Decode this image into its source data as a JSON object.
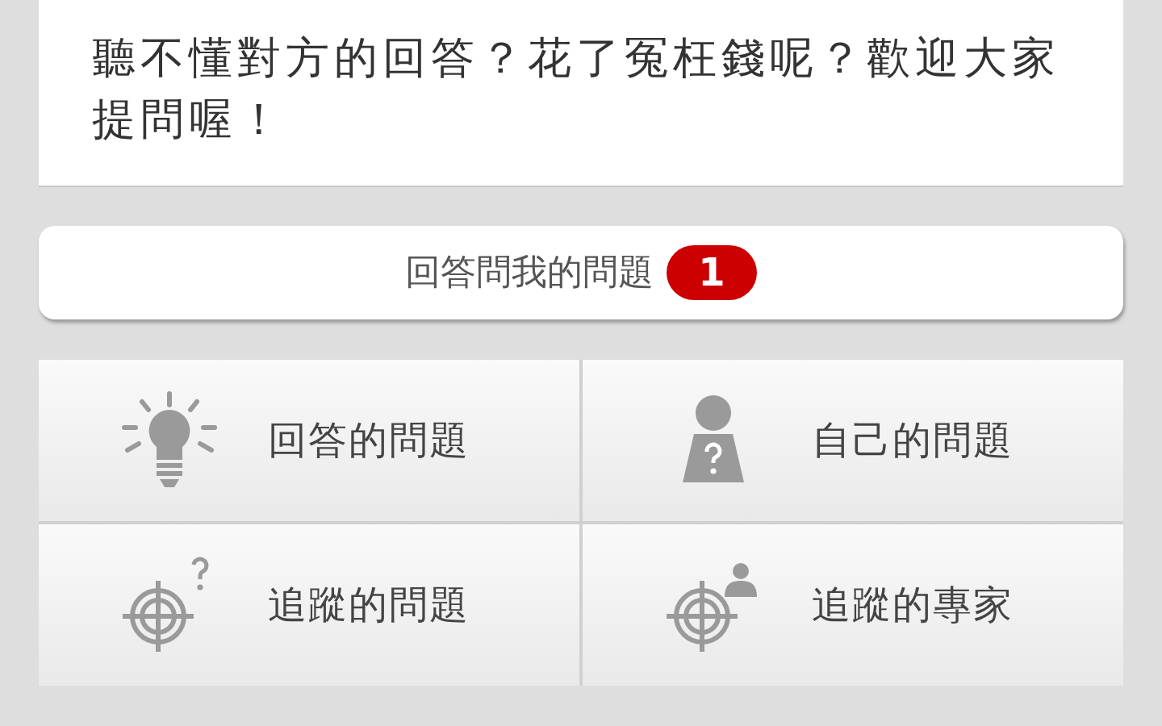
{
  "intro": {
    "text": "聽不懂對方的回答？花了冤枉錢呢？歡迎大家提問喔！"
  },
  "answer_button": {
    "label": "回答問我的問題",
    "badge": "1"
  },
  "menu": [
    {
      "kind": "bulb",
      "label": "回答的問題"
    },
    {
      "kind": "person",
      "label": "自己的問題"
    },
    {
      "kind": "target-question",
      "label": "追蹤的問題"
    },
    {
      "kind": "target-person",
      "label": "追蹤的專家"
    }
  ]
}
